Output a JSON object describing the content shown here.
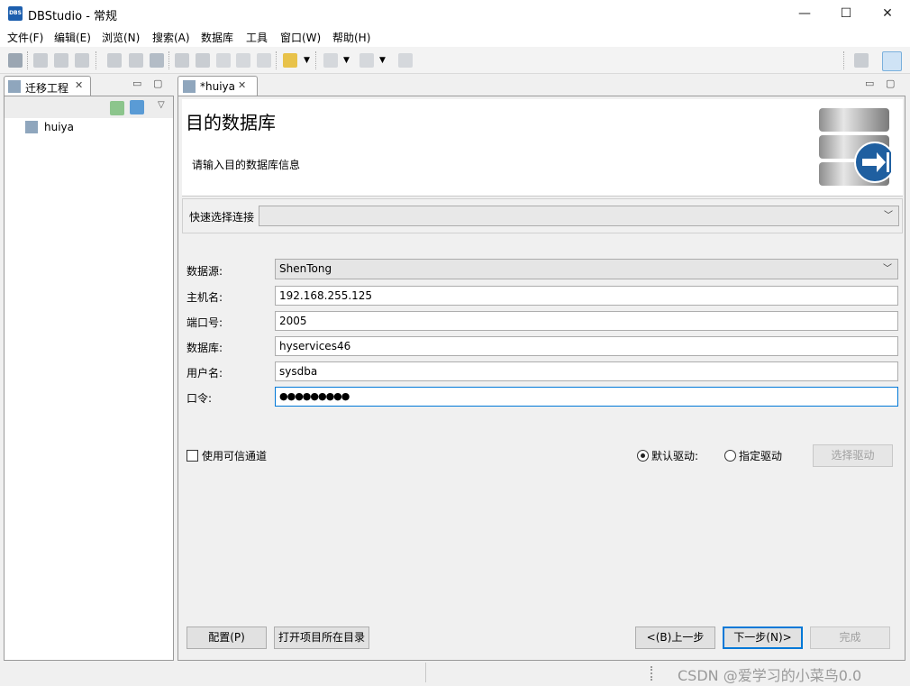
{
  "window": {
    "app_icon_text": "DBS",
    "title": "DBStudio - 常规",
    "minimize": "—",
    "maximize": "☐",
    "close": "✕"
  },
  "menu": [
    "文件(F)",
    "编辑(E)",
    "浏览(N)",
    "搜索(A)",
    "数据库",
    "工具",
    "窗口(W)",
    "帮助(H)"
  ],
  "project_panel": {
    "tab_label": "迁移工程",
    "tree_items": [
      "huiya"
    ]
  },
  "editor": {
    "tab_label": "*huiya",
    "header_title": "目的数据库",
    "header_subtitle": "请输入目的数据库信息",
    "quick_connect_label": "快速选择连接",
    "quick_connect_value": "",
    "fields": {
      "datasource_label": "数据源:",
      "datasource_value": "ShenTong",
      "host_label": "主机名:",
      "host_value": "192.168.255.125",
      "port_label": "端口号:",
      "port_value": "2005",
      "database_label": "数据库:",
      "database_value": "hyservices46",
      "user_label": "用户名:",
      "user_value": "sysdba",
      "password_label": "口令:",
      "password_value": "●●●●●●●●●"
    },
    "trusted_channel_label": "使用可信通道",
    "trusted_channel_checked": false,
    "default_driver_label": "默认驱动:",
    "specify_driver_label": "指定驱动",
    "driver_selected": "default",
    "select_driver_button": "选择驱动",
    "buttons": {
      "config": "配置(P)",
      "open_dir": "打开项目所在目录",
      "back": "<(B)上一步",
      "next": "下一步(N)>",
      "finish": "完成"
    }
  },
  "watermark": "CSDN @爱学习的小菜鸟0.0"
}
